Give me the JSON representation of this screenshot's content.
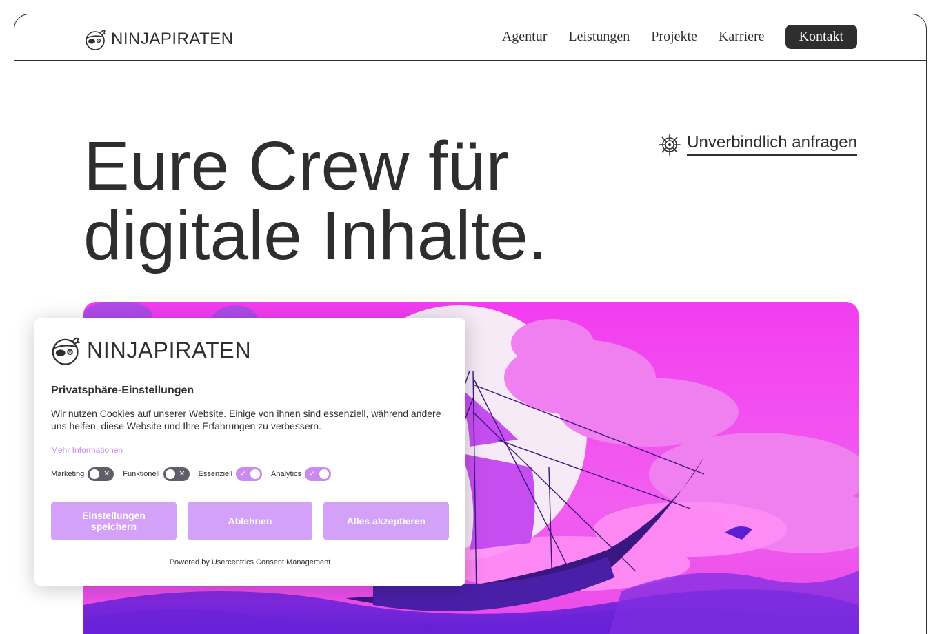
{
  "header": {
    "logo_text": "NINJAPIRATEN",
    "nav": [
      "Agentur",
      "Leistungen",
      "Projekte",
      "Karriere"
    ],
    "contact_label": "Kontakt"
  },
  "hero": {
    "title_line1": "Eure Crew für",
    "title_line2": "digitale Inhalte.",
    "cta_label": "Unverbindlich anfragen"
  },
  "consent": {
    "logo_text": "NINJAPIRATEN",
    "title": "Privatsphäre-Einstellungen",
    "description": "Wir nutzen Cookies auf unserer Website. Einige von ihnen sind essenziell, während andere uns helfen, diese Website und Ihre Erfahrungen zu verbessern.",
    "more_info": "Mehr Informationen",
    "toggles": [
      {
        "label": "Marketing",
        "on": false
      },
      {
        "label": "Funktionell",
        "on": false
      },
      {
        "label": "Essenziell",
        "on": true
      },
      {
        "label": "Analytics",
        "on": true
      }
    ],
    "save_label": "Einstellungen speichern",
    "decline_label": "Ablehnen",
    "accept_label": "Alles akzeptieren",
    "powered_by": "Powered by Usercentrics Consent Management"
  },
  "colors": {
    "text": "#2e2e2e",
    "accent": "#c98bf0",
    "button": "#d3a2f8",
    "hero_magenta": "#f23df0",
    "hero_purple": "#5a1fd0"
  },
  "icons": [
    "ninja-logo-icon",
    "ship-wheel-icon",
    "check-icon",
    "cross-icon"
  ]
}
